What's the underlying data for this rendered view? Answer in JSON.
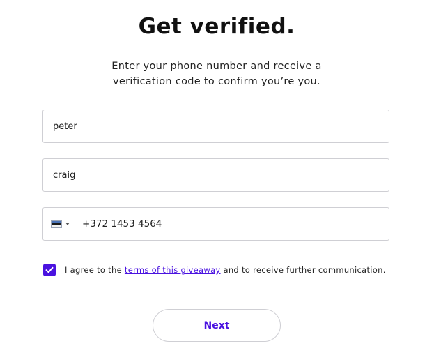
{
  "header": {
    "title": "Get verified.",
    "subtitle": "Enter your phone number and receive a verification code to confirm you’re you."
  },
  "form": {
    "first_name": {
      "value": "peter"
    },
    "last_name": {
      "value": "craig"
    },
    "phone": {
      "country_flag_icon": "estonia-flag-icon",
      "value": "+372 1453 4564"
    },
    "consent": {
      "checked": true,
      "text_before": "I agree to the ",
      "link_text": "terms of this giveaway",
      "text_after": " and to receive further communication."
    },
    "next_label": "Next"
  },
  "colors": {
    "accent": "#4a12e0",
    "border": "#cfcfd4"
  }
}
